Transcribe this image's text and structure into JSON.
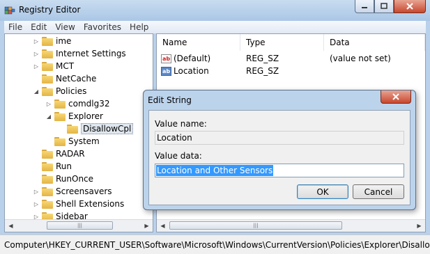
{
  "window": {
    "title": "Registry Editor"
  },
  "menu": [
    "File",
    "Edit",
    "View",
    "Favorites",
    "Help"
  ],
  "tree": [
    {
      "label": "ime",
      "depth": 0,
      "expanded": false
    },
    {
      "label": "Internet Settings",
      "depth": 0,
      "expanded": false
    },
    {
      "label": "MCT",
      "depth": 0,
      "expanded": false
    },
    {
      "label": "NetCache",
      "depth": 0,
      "expanded": null
    },
    {
      "label": "Policies",
      "depth": 0,
      "expanded": true
    },
    {
      "label": "comdlg32",
      "depth": 1,
      "expanded": false
    },
    {
      "label": "Explorer",
      "depth": 1,
      "expanded": true
    },
    {
      "label": "DisallowCpl",
      "depth": 2,
      "expanded": null,
      "selected": true
    },
    {
      "label": "System",
      "depth": 1,
      "expanded": null
    },
    {
      "label": "RADAR",
      "depth": 0,
      "expanded": null
    },
    {
      "label": "Run",
      "depth": 0,
      "expanded": null
    },
    {
      "label": "RunOnce",
      "depth": 0,
      "expanded": null
    },
    {
      "label": "Screensavers",
      "depth": 0,
      "expanded": false
    },
    {
      "label": "Shell Extensions",
      "depth": 0,
      "expanded": false
    },
    {
      "label": "Sidebar",
      "depth": 0,
      "expanded": false
    }
  ],
  "list": {
    "columns": [
      "Name",
      "Type",
      "Data"
    ],
    "rows": [
      {
        "icon": "string-value-icon",
        "name": "(Default)",
        "type": "REG_SZ",
        "data": "(value not set)"
      },
      {
        "icon": "string-value-icon",
        "name": "Location",
        "type": "REG_SZ",
        "data": ""
      }
    ]
  },
  "status": {
    "path": "Computer\\HKEY_CURRENT_USER\\Software\\Microsoft\\Windows\\CurrentVersion\\Policies\\Explorer\\DisallowCpl"
  },
  "dialog": {
    "title": "Edit String",
    "value_name_label": "Value name:",
    "value_name": "Location",
    "value_data_label": "Value data:",
    "value_data": "Location and Other Sensors",
    "ok_label": "OK",
    "cancel_label": "Cancel"
  },
  "colors": {
    "selection": "#3399ff",
    "frame": "#b9d1ea",
    "close": "#c8472e"
  }
}
